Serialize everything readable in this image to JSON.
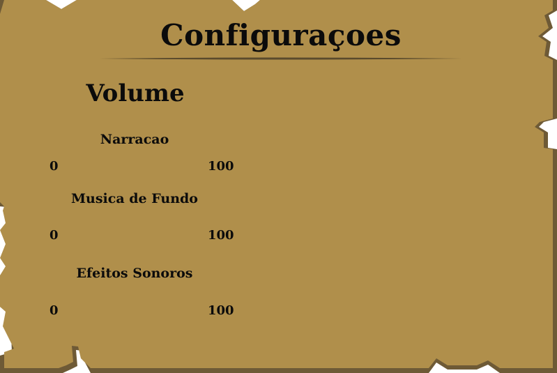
{
  "title": "Configuraçoes",
  "section": "Volume",
  "sliders": [
    {
      "label": "Narracao",
      "min_label": "0",
      "max_label": "100"
    },
    {
      "label": "Musica de Fundo",
      "min_label": "0",
      "max_label": "100"
    },
    {
      "label": "Efeitos Sonoros",
      "min_label": "0",
      "max_label": "100"
    }
  ],
  "colors": {
    "parchment": "#b08f4b",
    "parchment_edge": "#6e5a36",
    "text": "#0b0b0b",
    "rule": "#5a4a2c"
  }
}
